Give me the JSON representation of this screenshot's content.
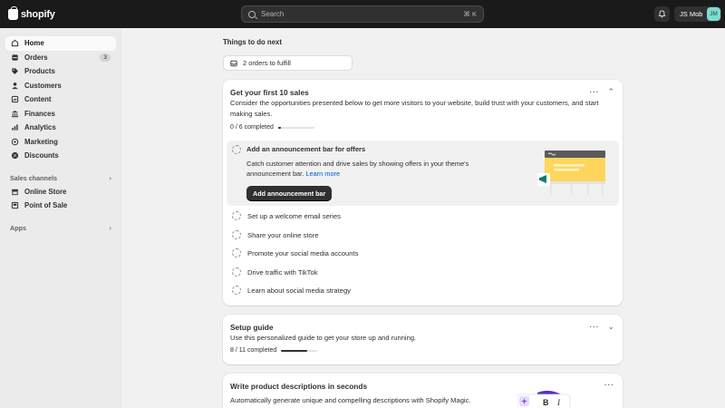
{
  "topbar": {
    "brand": "shopify",
    "search_placeholder": "Search",
    "search_shortcut": "⌘ K",
    "account_name": "JS Mob",
    "account_initials": "JM",
    "avatar_color": "#7fdccf"
  },
  "sidebar": {
    "items": [
      {
        "label": "Home",
        "icon": "home-icon"
      },
      {
        "label": "Orders",
        "icon": "orders-icon",
        "badge": "3"
      },
      {
        "label": "Products",
        "icon": "tag-icon"
      },
      {
        "label": "Customers",
        "icon": "person-icon"
      },
      {
        "label": "Content",
        "icon": "content-icon"
      },
      {
        "label": "Finances",
        "icon": "bank-icon"
      },
      {
        "label": "Analytics",
        "icon": "chart-icon"
      },
      {
        "label": "Marketing",
        "icon": "target-icon"
      },
      {
        "label": "Discounts",
        "icon": "discount-icon"
      }
    ],
    "sales_channels_label": "Sales channels",
    "channels": [
      {
        "label": "Online Store",
        "icon": "store-icon"
      },
      {
        "label": "Point of Sale",
        "icon": "pos-icon"
      }
    ],
    "apps_label": "Apps"
  },
  "main": {
    "section_title": "Things to do next",
    "orders_pill": "2 orders to fulfill",
    "first_sales": {
      "title": "Get your first 10 sales",
      "description": "Consider the opportunities presented below to get more visitors to your website, build trust with your customers, and start making sales.",
      "progress_label": "0 / 6 completed",
      "progress_fraction": 0.0,
      "open_task": {
        "title": "Add an announcement bar for offers",
        "description": "Catch customer attention and drive sales by showing offers in your theme's announcement bar.",
        "link": "Learn more",
        "button": "Add announcement bar"
      },
      "tasks": [
        "Set up a welcome email series",
        "Share your online store",
        "Promote your social media accounts",
        "Drive traffic with TikTok",
        "Learn about social media strategy"
      ]
    },
    "setup_guide": {
      "title": "Setup guide",
      "description": "Use this personalized guide to get your store up and running.",
      "progress_label": "8 / 11 completed",
      "progress_fraction": 0.727
    },
    "product_descriptions": {
      "title": "Write product descriptions in seconds",
      "description": "Automatically generate unique and compelling descriptions with Shopify Magic."
    }
  }
}
